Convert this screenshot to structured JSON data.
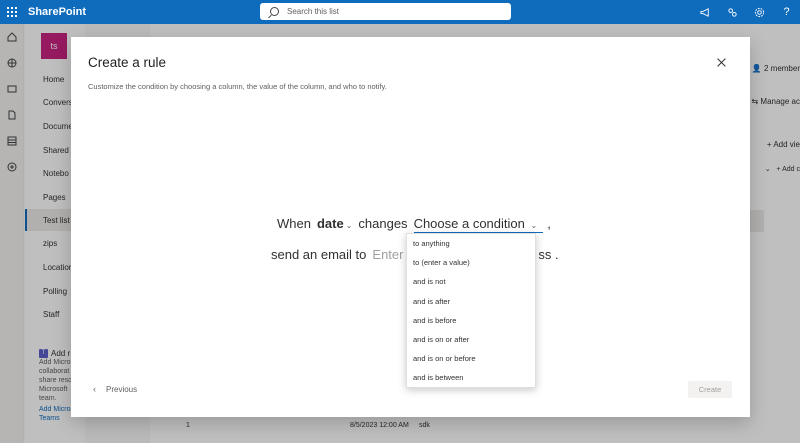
{
  "suitebar": {
    "brand": "SharePoint",
    "search_placeholder": "Search this list",
    "icons": [
      "megaphone-icon",
      "share-icon",
      "gear-icon",
      "help-icon"
    ]
  },
  "rail": {
    "icons": [
      "home-icon",
      "globe-icon",
      "news-icon",
      "file-icon",
      "list-icon",
      "add-icon"
    ]
  },
  "sitenav": {
    "site_initials": "ts",
    "items": [
      {
        "label": "Home"
      },
      {
        "label": "Conversa"
      },
      {
        "label": "Docume"
      },
      {
        "label": "Shared w"
      },
      {
        "label": "Notebo"
      },
      {
        "label": "Pages"
      },
      {
        "label": "Test list"
      },
      {
        "label": "zips"
      },
      {
        "label": "Location"
      },
      {
        "label": "Polling"
      },
      {
        "label": "Staff"
      }
    ],
    "active_index": 6,
    "add_teams": {
      "title": "Add r",
      "text_lines": [
        "Add Micro",
        "collaborat",
        "share reso",
        "Microsoft",
        "team."
      ],
      "link": "Add Microsoft Teams"
    }
  },
  "background": {
    "members": "2 member",
    "manage": "Manage ac",
    "add_view": "Add vie",
    "add_col": "Add c",
    "row_id": "1",
    "row_date": "8/5/2023 12:00 AM",
    "row_user": "sdk"
  },
  "modal": {
    "title": "Create a rule",
    "description": "Customize the condition by choosing a column, the value of the column, and who to notify.",
    "line1": {
      "when": "When",
      "column": "date",
      "changes": "changes",
      "condition_placeholder": "Choose a condition",
      "comma": ","
    },
    "line2": {
      "send": "send an email to",
      "email_placeholder": "Enter a",
      "tail": "ss ."
    },
    "previous_label": "Previous",
    "create_label": "Create"
  },
  "dropdown": {
    "options": [
      "to anything",
      "to (enter a value)",
      "and is not",
      "and is after",
      "and is before",
      "and is on or after",
      "and is on or before",
      "and is between"
    ]
  }
}
